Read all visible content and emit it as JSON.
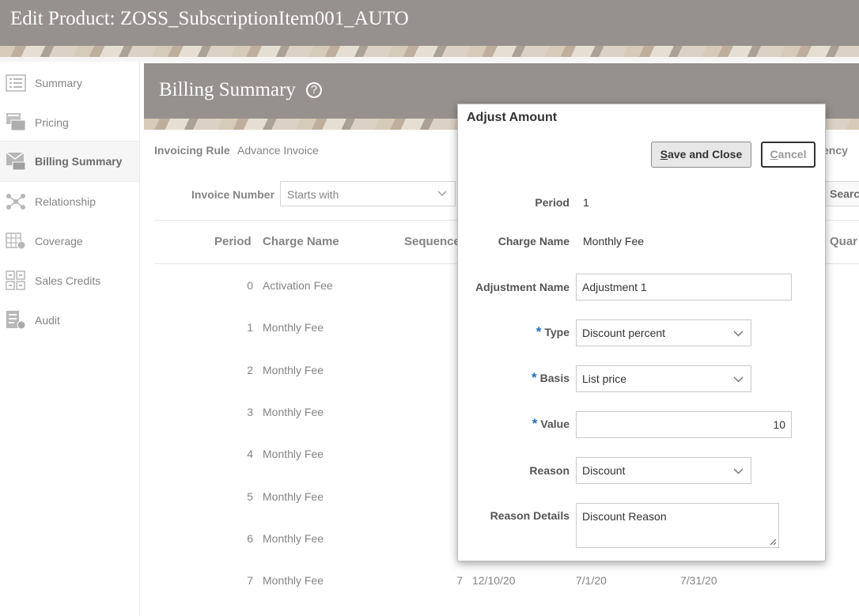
{
  "page": {
    "title": "Edit Product: ZOSS_SubscriptionItem001_AUTO"
  },
  "sidebar": {
    "items": [
      {
        "label": "Summary",
        "icon": "list-icon"
      },
      {
        "label": "Pricing",
        "icon": "pricing-icon"
      },
      {
        "label": "Billing Summary",
        "icon": "billing-icon",
        "selected": true
      },
      {
        "label": "Relationship",
        "icon": "relationship-icon"
      },
      {
        "label": "Coverage",
        "icon": "coverage-icon"
      },
      {
        "label": "Sales Credits",
        "icon": "sales-credits-icon"
      },
      {
        "label": "Audit",
        "icon": "audit-icon"
      }
    ]
  },
  "main": {
    "title": "Billing Summary",
    "help": "?",
    "invoicing_rule_label": "Invoicing Rule",
    "invoicing_rule_value": "Advance Invoice",
    "frequency_label_partial": "ency",
    "invoice_number_label": "Invoice Number",
    "invoice_number_operator": "Starts with",
    "search_label_partial": "Searc",
    "columns": [
      "Period",
      "Charge Name",
      "Sequence",
      "Quar"
    ],
    "rows": [
      {
        "period": "0",
        "charge": "Activation Fee",
        "seq": "",
        "d1": "",
        "d2": "",
        "d3": ""
      },
      {
        "period": "1",
        "charge": "Monthly Fee",
        "seq": "",
        "d1": "",
        "d2": "",
        "d3": ""
      },
      {
        "period": "2",
        "charge": "Monthly Fee",
        "seq": "",
        "d1": "",
        "d2": "",
        "d3": ""
      },
      {
        "period": "3",
        "charge": "Monthly Fee",
        "seq": "",
        "d1": "",
        "d2": "",
        "d3": ""
      },
      {
        "period": "4",
        "charge": "Monthly Fee",
        "seq": "",
        "d1": "",
        "d2": "",
        "d3": ""
      },
      {
        "period": "5",
        "charge": "Monthly Fee",
        "seq": "",
        "d1": "",
        "d2": "",
        "d3": ""
      },
      {
        "period": "6",
        "charge": "Monthly Fee",
        "seq": "",
        "d1": "",
        "d2": "",
        "d3": ""
      },
      {
        "period": "7",
        "charge": "Monthly Fee",
        "seq": "7",
        "d1": "12/10/20",
        "d2": "7/1/20",
        "d3": "7/31/20"
      }
    ]
  },
  "dialog": {
    "title": "Adjust Amount",
    "save_label_first": "S",
    "save_label_rest": "ave and Close",
    "cancel_label_first": "C",
    "cancel_label_rest": "ancel",
    "required_marker": "*",
    "period_label": "Period",
    "period_value": "1",
    "charge_name_label": "Charge Name",
    "charge_name_value": "Monthly Fee",
    "adjustment_name_label": "Adjustment Name",
    "adjustment_name_value": "Adjustment 1",
    "type_label": "Type",
    "type_value": "Discount percent",
    "basis_label": "Basis",
    "basis_value": "List price",
    "value_label": "Value",
    "value_value": "10",
    "reason_label": "Reason",
    "reason_value": "Discount",
    "reason_details_label": "Reason Details",
    "reason_details_value": "Discount Reason"
  },
  "colors": {
    "header_bg": "#6e6764",
    "required": "#1e6fb8",
    "dialog_border": "#bdbdbd"
  }
}
